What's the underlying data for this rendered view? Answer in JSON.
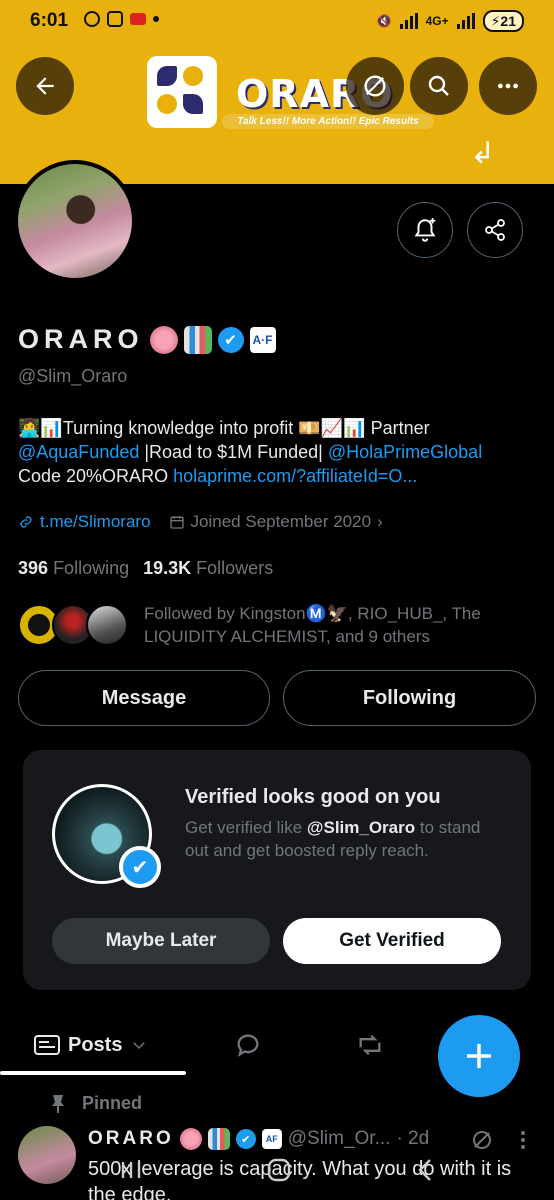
{
  "status_bar": {
    "time": "6:01",
    "network": "4G+",
    "battery": "21"
  },
  "banner": {
    "brand": "ORARO",
    "tagline": "Talk Less!! More Action!! Epic Results"
  },
  "header": {
    "back_icon": "arrow-left-icon",
    "search_icon": "search-icon",
    "more_icon": "more-horizontal-icon"
  },
  "actions": {
    "notify_icon": "bell-plus-icon",
    "share_icon": "share-icon"
  },
  "profile": {
    "name": "ORARO",
    "af_badge": "A·F",
    "handle": "@Slim_Oraro",
    "bio_line1_text": "Turning knowledge into profit",
    "bio_line1_suffix": "Partner",
    "bio_mention1": "@AquaFunded",
    "bio_mid": "|Road to $1M Funded|",
    "bio_mention2": "@HolaPrimeGlobal",
    "bio_code": "Code 20%ORARO",
    "bio_link": "holaprime.com/?affiliateId=O...",
    "website": "t.me/Slimoraro",
    "joined": "Joined September 2020",
    "following_count": "396",
    "following_label": "Following",
    "followers_count": "19.3K",
    "followers_label": "Followers",
    "followed_by": "Followed by KingstonⓂ️🦅, RIO_HUB_, The LIQUIDITY ALCHEMIST, and 9 others"
  },
  "buttons": {
    "message": "Message",
    "following": "Following"
  },
  "verify_card": {
    "title": "Verified looks good on you",
    "desc_prefix": "Get verified like",
    "desc_handle": "@Slim_Oraro",
    "desc_suffix": "to stand out and get boosted reply reach.",
    "maybe_later": "Maybe Later",
    "get_verified": "Get Verified"
  },
  "tabs": {
    "posts": "Posts"
  },
  "pinned_post": {
    "pinned_label": "Pinned",
    "author": "ORARO",
    "af_badge": "AF",
    "handle": "@Slim_Or...",
    "time": "· 2d",
    "text": "500x leverage is capacity. What you do with it is the edge."
  },
  "colors": {
    "banner": "#e8b10e",
    "accent": "#1d9bf0",
    "background": "#000000",
    "muted": "#71767b"
  }
}
